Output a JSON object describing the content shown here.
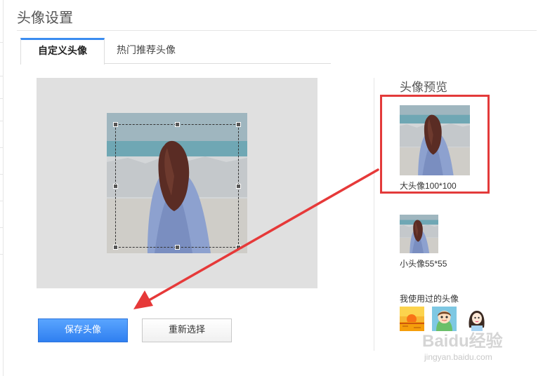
{
  "page": {
    "title": "头像设置"
  },
  "tabs": [
    {
      "label": "自定义头像",
      "active": true
    },
    {
      "label": "热门推荐头像",
      "active": false
    }
  ],
  "crop": {
    "photo": "girl-back-seaside-photo"
  },
  "buttons": {
    "save_label": "保存头像",
    "reselect_label": "重新选择"
  },
  "preview": {
    "title": "头像预览",
    "large_label": "大头像100*100",
    "small_label": "小头像55*55"
  },
  "used": {
    "title": "我使用过的头像",
    "avatars": [
      "sunset-avatar",
      "cartoon-girl-avatar",
      "drawn-girl-avatar"
    ]
  },
  "watermark": {
    "brand": "Baidu经验",
    "url": "jingyan.baidu.com"
  },
  "colors": {
    "accent": "#3b8cf0",
    "save_button": "#3a8bf5",
    "highlight_box": "#e33a3a"
  }
}
